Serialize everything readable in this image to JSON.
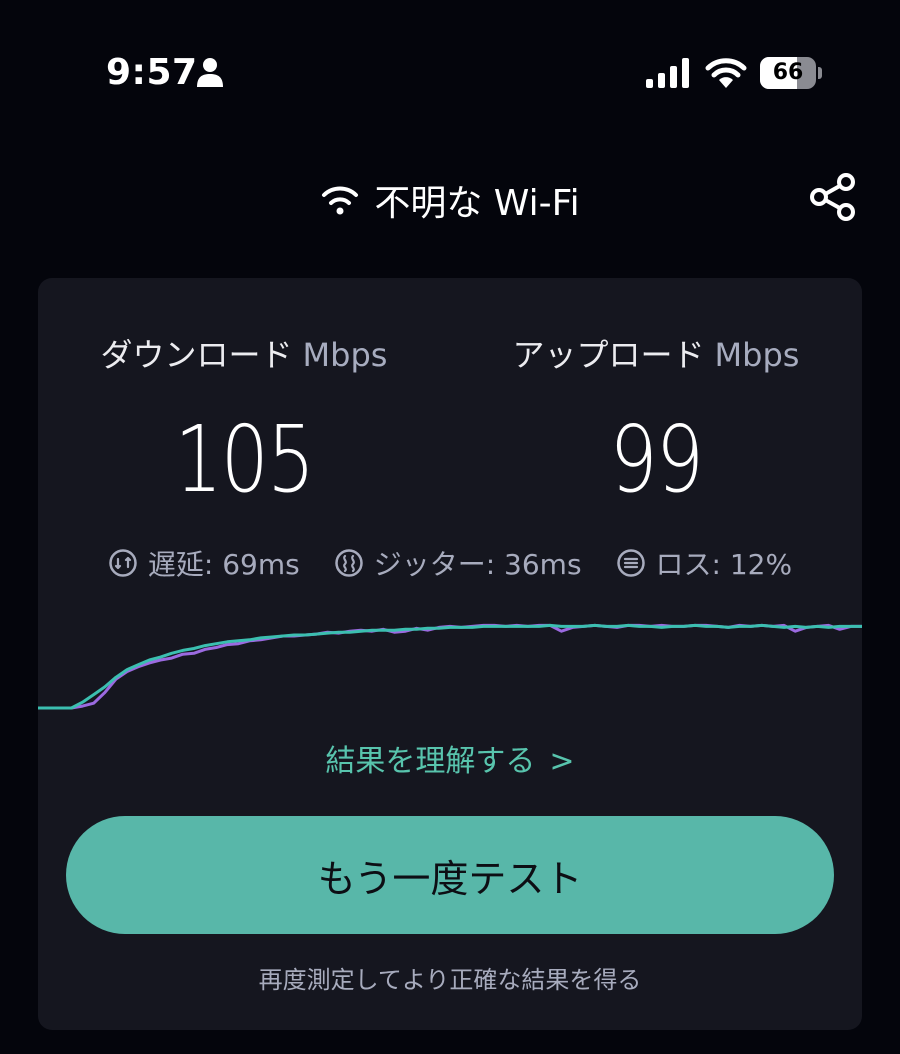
{
  "status_bar": {
    "time": "9:57",
    "battery_level": 66,
    "battery_text": "66"
  },
  "header": {
    "network_name": "不明な Wi-Fi"
  },
  "results": {
    "download": {
      "label": "ダウンロード",
      "unit": "Mbps",
      "value": "105"
    },
    "upload": {
      "label": "アップロード",
      "unit": "Mbps",
      "value": "99"
    },
    "stats": {
      "latency": "遅延: 69ms",
      "jitter": "ジッター: 36ms",
      "loss": "ロス: 12%"
    }
  },
  "chart_data": {
    "type": "line",
    "xlabel": "",
    "ylabel": "",
    "ylim": [
      0,
      100
    ],
    "grid": false,
    "series": [
      {
        "color": "#9b6ae0",
        "values": [
          0,
          0,
          0,
          0,
          2,
          5,
          16,
          30,
          38,
          43,
          47,
          50,
          52,
          56,
          57,
          61,
          63,
          66,
          67,
          70,
          71,
          73,
          75,
          75,
          76,
          77,
          79,
          78,
          80,
          81,
          80,
          82,
          79,
          80,
          83,
          81,
          84,
          85,
          84,
          85,
          86,
          86,
          85,
          86,
          85,
          86,
          86,
          80,
          84,
          85,
          86,
          85,
          84,
          86,
          86,
          85,
          86,
          85,
          85,
          86,
          86,
          85,
          84,
          86,
          85,
          86,
          85,
          86,
          80,
          84,
          85,
          86,
          82,
          85,
          85
        ]
      },
      {
        "color": "#3bbfb0",
        "values": [
          0,
          0,
          0,
          0,
          6,
          14,
          22,
          32,
          40,
          45,
          50,
          53,
          57,
          60,
          62,
          65,
          67,
          69,
          70,
          71,
          73,
          74,
          75,
          76,
          76,
          77,
          78,
          79,
          79,
          80,
          81,
          81,
          81,
          82,
          82,
          83,
          83,
          84,
          84,
          84,
          85,
          85,
          85,
          85,
          85,
          85,
          86,
          85,
          85,
          85,
          86,
          85,
          85,
          86,
          85,
          85,
          84,
          85,
          85,
          86,
          85,
          85,
          84,
          85,
          85,
          86,
          85,
          84,
          85,
          84,
          85,
          84,
          85,
          85,
          85
        ]
      }
    ]
  },
  "links": {
    "understand_results": "結果を理解する",
    "chevron": ">"
  },
  "actions": {
    "retest_label": "もう一度テスト",
    "hint": "再度測定してより正確な結果を得る"
  },
  "colors": {
    "accent": "#58b7a9",
    "link": "#58c4ad",
    "card_bg": "#15161f",
    "screen_bg": "#04050c"
  }
}
